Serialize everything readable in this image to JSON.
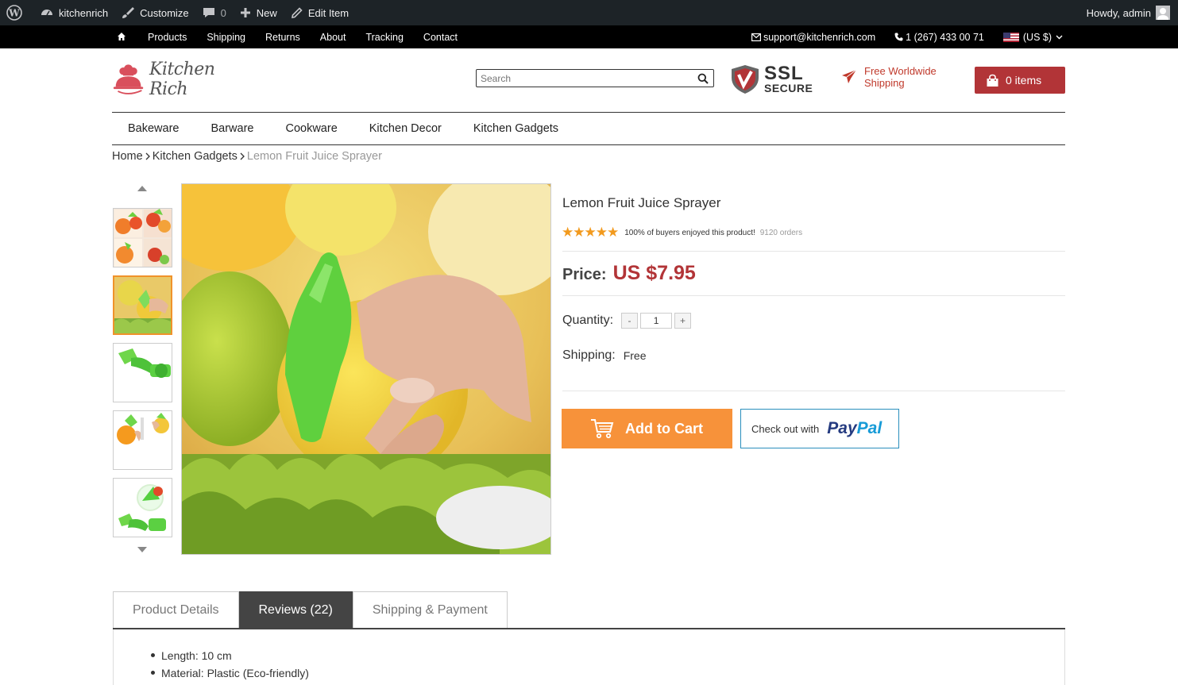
{
  "adminbar": {
    "site_name": "kitchenrich",
    "customize": "Customize",
    "comments_count": "0",
    "new": "New",
    "edit_item": "Edit Item",
    "howdy": "Howdy, admin"
  },
  "topnav": {
    "links": [
      "Products",
      "Shipping",
      "Returns",
      "About",
      "Tracking",
      "Contact"
    ],
    "email": "support@kitchenrich.com",
    "phone": "1 (267) 433 00 71",
    "currency": "(US $)"
  },
  "header": {
    "logo_text": "Kitchen Rich",
    "search_placeholder": "Search",
    "ssl_big": "SSL",
    "ssl_small": "SECURE",
    "free_shipping_line1": "Free Worldwide",
    "free_shipping_line2": "Shipping",
    "cart_label": "0 items"
  },
  "categories": [
    "Bakeware",
    "Barware",
    "Cookware",
    "Kitchen Decor",
    "Kitchen Gadgets"
  ],
  "breadcrumb": {
    "home": "Home",
    "category": "Kitchen Gadgets",
    "current": "Lemon Fruit Juice Sprayer"
  },
  "product": {
    "title": "Lemon Fruit Juice Sprayer",
    "stars": "★★★★★",
    "enjoyed": "100% of buyers enjoyed this product!",
    "orders": "9120 orders",
    "price_label": "Price:",
    "price": "US $7.95",
    "quantity_label": "Quantity:",
    "quantity": "1",
    "qty_minus": "-",
    "qty_plus": "+",
    "shipping_label": "Shipping:",
    "shipping_value": "Free",
    "add_to_cart": "Add to Cart",
    "checkout_with": "Check out with",
    "paypal_1": "Pay",
    "paypal_2": "Pal"
  },
  "tabs": [
    "Product Details",
    "Reviews (22)",
    "Shipping & Payment"
  ],
  "specs": [
    "Length: 10 cm",
    "Material: Plastic (Eco-friendly)"
  ],
  "colors": {
    "brand_red": "#b23437",
    "cart_orange": "#f7923a",
    "star": "#f29a1e"
  }
}
